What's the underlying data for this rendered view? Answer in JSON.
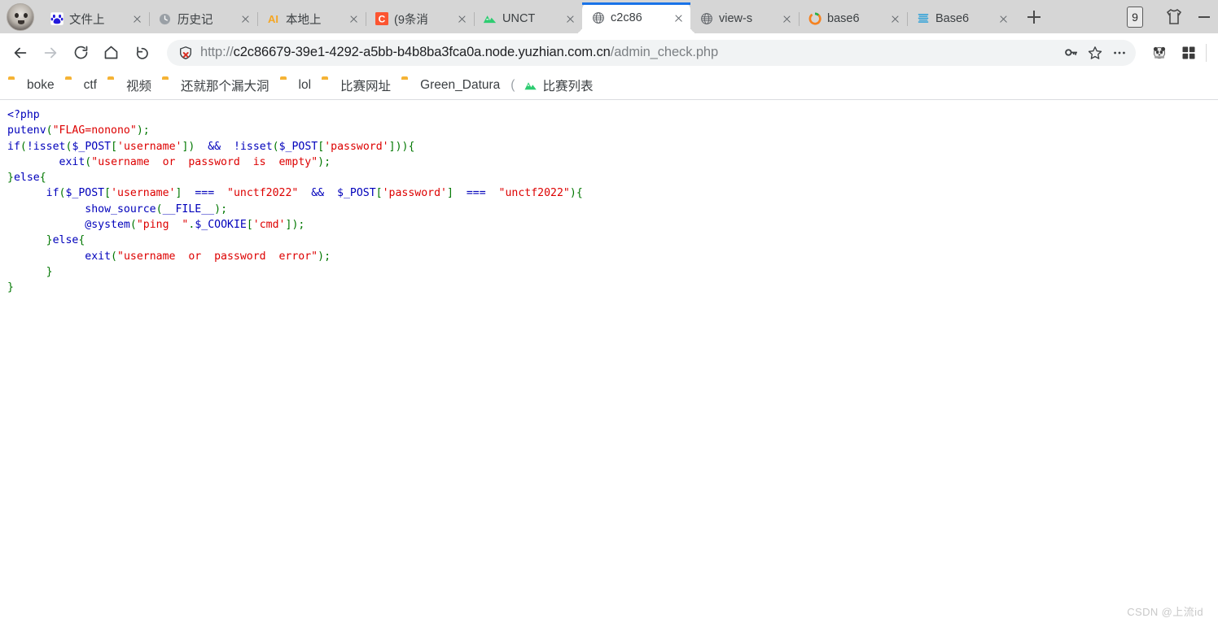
{
  "window": {
    "profile_avatar_name": "user-avatar"
  },
  "tabstrip": {
    "tabs": [
      {
        "title": "文件上",
        "favicon": "baidu-icon",
        "active": false,
        "close_label": "×"
      },
      {
        "title": "历史记",
        "favicon": "clock-icon",
        "active": false,
        "close_label": "×"
      },
      {
        "title": "本地上",
        "favicon": "ai-icon",
        "active": false,
        "close_label": "×"
      },
      {
        "title": "(9条消",
        "favicon": "csdn-icon",
        "active": false,
        "close_label": "×"
      },
      {
        "title": "UNCT",
        "favicon": "unct-icon",
        "active": false,
        "close_label": "×"
      },
      {
        "title": "c2c86",
        "favicon": "globe-icon",
        "active": true,
        "close_label": "×"
      },
      {
        "title": "view-s",
        "favicon": "globe-icon",
        "active": false,
        "close_label": "×"
      },
      {
        "title": "base6",
        "favicon": "odysee-icon",
        "active": false,
        "close_label": "×"
      },
      {
        "title": "Base6",
        "favicon": "base64-icon",
        "active": false,
        "close_label": "×"
      }
    ],
    "new_tab_label": "+",
    "badge_count": "9",
    "shirt_icon": "tshirt-icon",
    "menu_icon": "window-minimize-icon"
  },
  "toolbar": {
    "back": "back-arrow-icon",
    "forward": "forward-arrow-icon",
    "reload": "reload-icon",
    "home": "home-icon",
    "history_back": "undo-icon",
    "security_icon": "not-secure-shield-icon",
    "url": {
      "scheme": "http://",
      "host": "c2c86679-39e1-4292-a5bb-b4b8ba3fca0a.node.yuzhian.com.cn",
      "path": "/admin_check.php",
      "full": "http://c2c86679-39e1-4292-a5bb-b4b8ba3fca0a.node.yuzhian.com.cn/admin_check.php"
    },
    "key_icon": "password-key-icon",
    "star_icon": "bookmark-star-icon",
    "more_icon": "more-options-icon",
    "extension_icon": "panda-extension-icon",
    "apps_icon": "apps-grid-icon"
  },
  "bookmarks": {
    "items": [
      {
        "label": "boke",
        "icon": "folder-icon"
      },
      {
        "label": "ctf",
        "icon": "folder-icon"
      },
      {
        "label": "视频",
        "icon": "folder-icon"
      },
      {
        "label": "还就那个漏大洞",
        "icon": "folder-icon"
      },
      {
        "label": "lol",
        "icon": "folder-icon"
      },
      {
        "label": "比赛网址",
        "icon": "folder-icon"
      },
      {
        "label": "Green_Datura",
        "icon": "folder-icon"
      }
    ],
    "separator": "(",
    "last_item": {
      "label": "比赛列表",
      "icon": "unct-icon"
    }
  },
  "page": {
    "watermark": "CSDN @上流id",
    "code_lines": [
      [
        {
          "t": "<?php",
          "c": "kw"
        }
      ],
      [
        {
          "t": "putenv",
          "c": "fn"
        },
        {
          "t": "(",
          "c": "pun"
        },
        {
          "t": "\"FLAG=nonono\"",
          "c": "str"
        },
        {
          "t": ")",
          "c": "pun"
        },
        {
          "t": ";",
          "c": "pun"
        }
      ],
      [
        {
          "t": "if",
          "c": "fn"
        },
        {
          "t": "(",
          "c": "pun"
        },
        {
          "t": "!",
          "c": "fn"
        },
        {
          "t": "isset",
          "c": "fn"
        },
        {
          "t": "(",
          "c": "pun"
        },
        {
          "t": "$_POST",
          "c": "var"
        },
        {
          "t": "[",
          "c": "idx"
        },
        {
          "t": "'username'",
          "c": "str"
        },
        {
          "t": "]",
          "c": "idx"
        },
        {
          "t": ")",
          "c": "pun"
        },
        {
          "t": "  &&  ",
          "c": "fn"
        },
        {
          "t": "!",
          "c": "fn"
        },
        {
          "t": "isset",
          "c": "fn"
        },
        {
          "t": "(",
          "c": "pun"
        },
        {
          "t": "$_POST",
          "c": "var"
        },
        {
          "t": "[",
          "c": "idx"
        },
        {
          "t": "'password'",
          "c": "str"
        },
        {
          "t": "]",
          "c": "idx"
        },
        {
          "t": "))",
          "c": "pun"
        },
        {
          "t": "{",
          "c": "pun"
        }
      ],
      [
        {
          "t": "        ",
          "c": "dflt"
        },
        {
          "t": "exit",
          "c": "fn"
        },
        {
          "t": "(",
          "c": "pun"
        },
        {
          "t": "\"username  or  password  is  empty\"",
          "c": "str"
        },
        {
          "t": ")",
          "c": "pun"
        },
        {
          "t": ";",
          "c": "pun"
        }
      ],
      [
        {
          "t": "}",
          "c": "pun"
        },
        {
          "t": "else",
          "c": "fn"
        },
        {
          "t": "{",
          "c": "pun"
        }
      ],
      [
        {
          "t": "      ",
          "c": "dflt"
        },
        {
          "t": "if",
          "c": "fn"
        },
        {
          "t": "(",
          "c": "pun"
        },
        {
          "t": "$_POST",
          "c": "var"
        },
        {
          "t": "[",
          "c": "idx"
        },
        {
          "t": "'username'",
          "c": "str"
        },
        {
          "t": "]",
          "c": "idx"
        },
        {
          "t": "  ===  ",
          "c": "fn"
        },
        {
          "t": "\"unctf2022\"",
          "c": "str"
        },
        {
          "t": "  &&  ",
          "c": "fn"
        },
        {
          "t": "$_POST",
          "c": "var"
        },
        {
          "t": "[",
          "c": "idx"
        },
        {
          "t": "'password'",
          "c": "str"
        },
        {
          "t": "]",
          "c": "idx"
        },
        {
          "t": "  ===  ",
          "c": "fn"
        },
        {
          "t": "\"unctf2022\"",
          "c": "str"
        },
        {
          "t": ")",
          "c": "pun"
        },
        {
          "t": "{",
          "c": "pun"
        }
      ],
      [
        {
          "t": "            ",
          "c": "dflt"
        },
        {
          "t": "show_source",
          "c": "fn"
        },
        {
          "t": "(",
          "c": "pun"
        },
        {
          "t": "__FILE__",
          "c": "var"
        },
        {
          "t": ")",
          "c": "pun"
        },
        {
          "t": ";",
          "c": "pun"
        }
      ],
      [
        {
          "t": "            ",
          "c": "dflt"
        },
        {
          "t": "@",
          "c": "fn"
        },
        {
          "t": "system",
          "c": "fn"
        },
        {
          "t": "(",
          "c": "pun"
        },
        {
          "t": "\"ping  \"",
          "c": "str"
        },
        {
          "t": ".",
          "c": "pun"
        },
        {
          "t": "$_COOKIE",
          "c": "var"
        },
        {
          "t": "[",
          "c": "idx"
        },
        {
          "t": "'cmd'",
          "c": "str"
        },
        {
          "t": "]",
          "c": "idx"
        },
        {
          "t": ")",
          "c": "pun"
        },
        {
          "t": ";",
          "c": "pun"
        }
      ],
      [
        {
          "t": "      ",
          "c": "dflt"
        },
        {
          "t": "}",
          "c": "pun"
        },
        {
          "t": "else",
          "c": "fn"
        },
        {
          "t": "{",
          "c": "pun"
        }
      ],
      [
        {
          "t": "            ",
          "c": "dflt"
        },
        {
          "t": "exit",
          "c": "fn"
        },
        {
          "t": "(",
          "c": "pun"
        },
        {
          "t": "\"username  or  password  error\"",
          "c": "str"
        },
        {
          "t": ")",
          "c": "pun"
        },
        {
          "t": ";",
          "c": "pun"
        }
      ],
      [
        {
          "t": "      ",
          "c": "dflt"
        },
        {
          "t": "}",
          "c": "pun"
        }
      ],
      [
        {
          "t": "}",
          "c": "pun"
        }
      ]
    ]
  },
  "colors": {
    "accent": "#1a73e8",
    "tabstrip_bg": "#d6d6d6",
    "string": "#DD0000",
    "keyword": "#0000BB",
    "index": "#007700",
    "folder": "#f5b335"
  }
}
